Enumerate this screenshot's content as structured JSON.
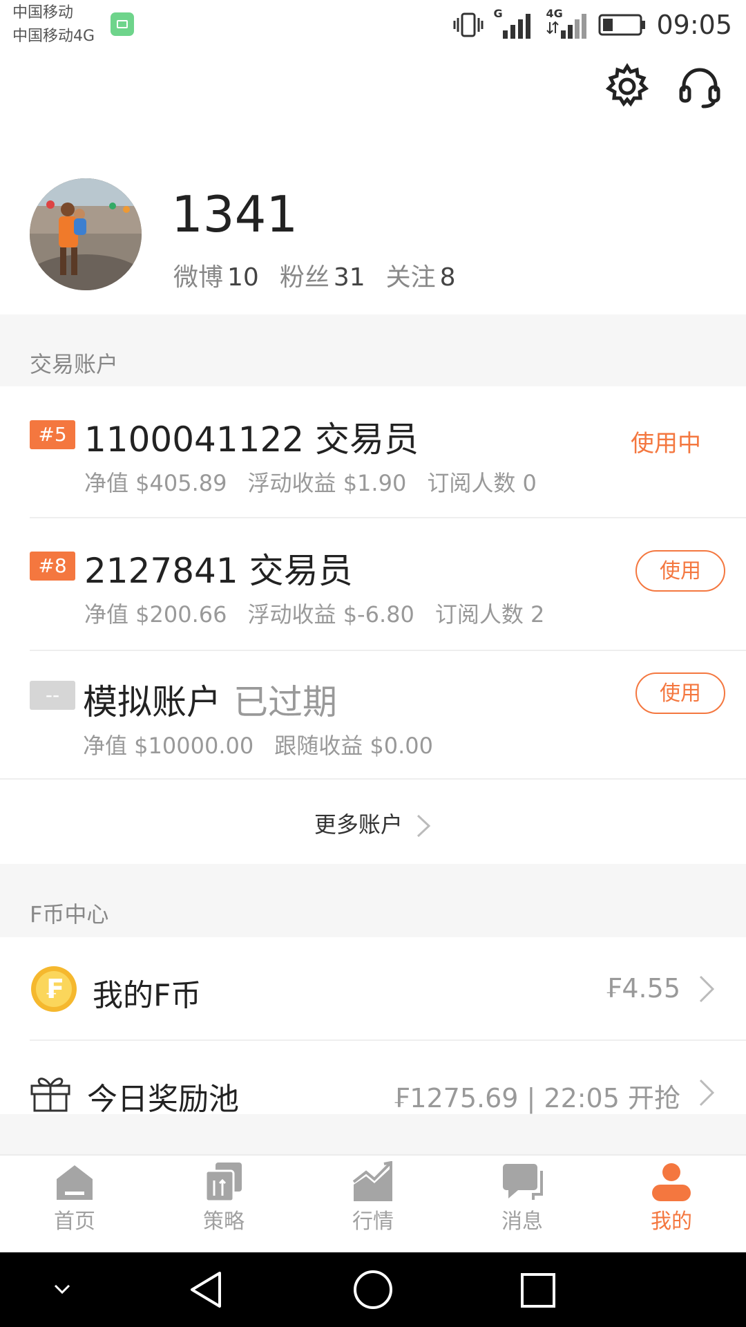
{
  "status_bar": {
    "carrier_line1": "中国移动",
    "carrier_line2": "中国移动4G",
    "net1": "G",
    "net2": "4G",
    "time": "09:05"
  },
  "profile": {
    "username": "1341",
    "stats": [
      {
        "label": "微博",
        "value": "10"
      },
      {
        "label": "粉丝",
        "value": "31"
      },
      {
        "label": "关注",
        "value": "8"
      }
    ]
  },
  "trading": {
    "section_label": "交易账户",
    "accounts": [
      {
        "badge": "#5",
        "title": "1100041122 交易员",
        "sub": [
          "净值 $405.89",
          "浮动收益 $1.90",
          "订阅人数 0"
        ],
        "status": "使用中"
      },
      {
        "badge": "#8",
        "title": "2127841 交易员",
        "sub": [
          "净值 $200.66",
          "浮动收益 $-6.80",
          "订阅人数 2"
        ],
        "button": "使用"
      },
      {
        "badge": "--",
        "title": "模拟账户",
        "expired": "已过期",
        "sub": [
          "净值 $10000.00",
          "跟随收益 $0.00"
        ],
        "button": "使用"
      }
    ],
    "more": "更多账户"
  },
  "fcoin": {
    "section_label": "F币中心",
    "my_coin": {
      "icon_glyph": "₣",
      "label": "我的F币",
      "value": "₣4.55"
    },
    "reward_pool": {
      "label": "今日奖励池",
      "value": "₣1275.69 | 22:05 开抢"
    }
  },
  "tabs": [
    {
      "label": "首页",
      "icon": "home-icon"
    },
    {
      "label": "策略",
      "icon": "strategy-icon"
    },
    {
      "label": "行情",
      "icon": "market-icon"
    },
    {
      "label": "消息",
      "icon": "message-icon"
    },
    {
      "label": "我的",
      "icon": "profile-icon",
      "active": true
    }
  ],
  "colors": {
    "accent": "#f4773f",
    "muted": "#999999",
    "section_bg": "#f6f6f6"
  }
}
